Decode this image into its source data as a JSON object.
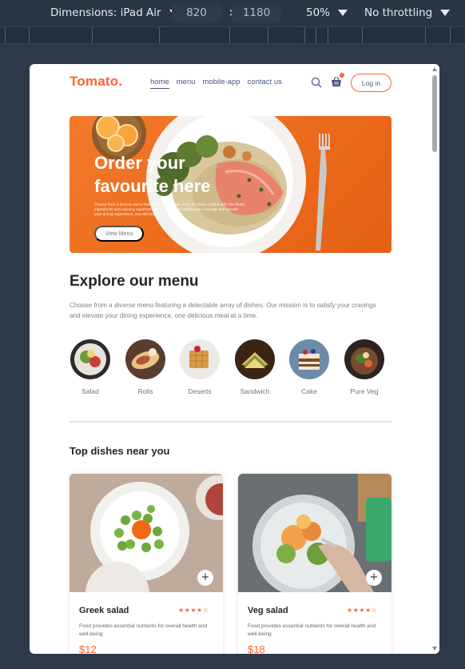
{
  "devtools": {
    "dimensions_label": "Dimensions: iPad Air",
    "width": "820",
    "times": "×",
    "height": "1180",
    "zoom": "50%",
    "throttling": "No throttling"
  },
  "header": {
    "logo": "Tomato.",
    "nav": [
      {
        "label": "home",
        "active": true
      },
      {
        "label": "menu"
      },
      {
        "label": "mobile-app"
      },
      {
        "label": "contact us"
      }
    ],
    "login_label": "Log in"
  },
  "hero": {
    "title_line1": "Order your",
    "title_line2": "favourite here",
    "subtitle": "Choose from a diverse menu featuring a delectable array of dishes crafted with the finest ingredients and culinary expertise. Our mission is to satisfy your cravings and elevate your dining experience, one delicious meal at a time.",
    "button_label": "View Menu"
  },
  "explore": {
    "title": "Explore our menu",
    "description": "Choose from a diverse menu featuring a delectable array of dishes. Our mission is to satisfy your cravings and elevate your dining experience, one delicious meal at a time.",
    "items": [
      {
        "label": "Salad"
      },
      {
        "label": "Rolls"
      },
      {
        "label": "Deserts"
      },
      {
        "label": "Sandwich"
      },
      {
        "label": "Cake"
      },
      {
        "label": "Pure Veg"
      }
    ]
  },
  "top_dishes": {
    "title": "Top dishes near you",
    "cards": [
      {
        "name": "Greek salad",
        "stars": "★★★★☆",
        "desc": "Food provides essential nutrients for overall health and well-being",
        "price": "$12",
        "add": "+"
      },
      {
        "name": "Veg salad",
        "stars": "★★★★☆",
        "desc": "Food provides essential nutrients for overall health and well-being",
        "price": "$18",
        "add": "+"
      }
    ]
  },
  "colors": {
    "accent": "#ff6233",
    "nav_text": "#49557e",
    "hero_bg": "#ec6a1c"
  }
}
